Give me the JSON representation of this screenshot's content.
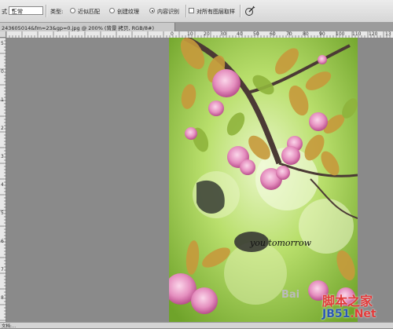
{
  "options_bar": {
    "mode_label": "式",
    "mode_value": "正常",
    "type_label": "类型:",
    "type_options": [
      {
        "label": "近似匹配",
        "selected": false
      },
      {
        "label": "创建纹理",
        "selected": false
      },
      {
        "label": "内容识别",
        "selected": true
      }
    ],
    "sample_all_layers_label": "对所有图层取样",
    "sample_all_layers_checked": false,
    "brush_icon": "pressure-brush-icon"
  },
  "document_tab": {
    "title": "243605014&fm=23&gp=0.jpg @ 200% (背景 拷贝, RGB/8#)"
  },
  "ruler": {
    "horizontal_labels": [
      "0",
      "10",
      "20",
      "30",
      "40",
      "50",
      "60",
      "70",
      "80",
      "90",
      "100",
      "110",
      "120",
      "13"
    ],
    "vertical_labels": [
      "5",
      "0",
      "1",
      "2",
      "3",
      "4",
      "5",
      "6",
      "7",
      "8"
    ]
  },
  "canvas": {
    "overlay_text": "you tomorrow"
  },
  "status_bar": {
    "text": "文档:..."
  },
  "watermark": {
    "logo_text": "Bai",
    "brand_text": "脚本之家",
    "site_text_prefix": "JB51",
    "site_text_suffix": ".Net"
  }
}
